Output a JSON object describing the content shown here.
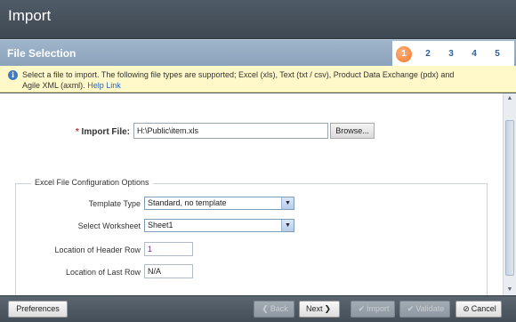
{
  "window": {
    "title": "Import"
  },
  "stepbar": {
    "section_title": "File Selection",
    "steps": [
      "1",
      "2",
      "3",
      "4",
      "5"
    ],
    "active_step": "1"
  },
  "info": {
    "text": "Select a file to import. The following file types are supported; Excel (xls), Text (txt / csv), Product Data Exchange (pdx) and Agile XML (axml).",
    "help_link": "Help Link"
  },
  "form": {
    "required_mark": "*",
    "import_file_label": "Import File:",
    "import_file_value": "H:\\Public\\item.xls",
    "browse_label": "Browse..."
  },
  "excel_options": {
    "legend": "Excel File Configuration Options",
    "template_type_label": "Template Type",
    "template_type_value": "Standard, no template",
    "worksheet_label": "Select Worksheet",
    "worksheet_value": "Sheet1",
    "header_row_label": "Location of Header Row",
    "header_row_value": "1",
    "last_row_label": "Location of Last Row",
    "last_row_value": "N/A"
  },
  "footer": {
    "preferences": "Preferences",
    "back": "Back",
    "next": "Next",
    "import": "Import",
    "validate": "Validate",
    "cancel": "Cancel"
  },
  "colors": {
    "title_bar": "#4a5660",
    "step_bar": "#94abc3",
    "active_step": "#f07a30",
    "info_bg": "#fff8c8",
    "link": "#2a66b5"
  }
}
